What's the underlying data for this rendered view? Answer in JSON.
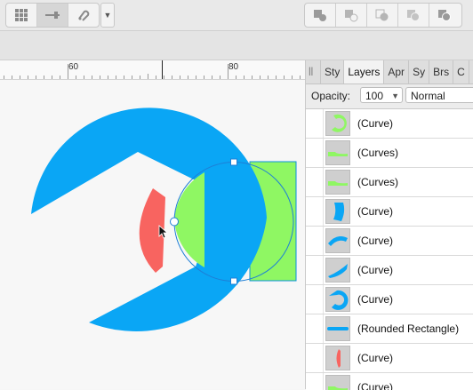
{
  "toolbar": {
    "left_group": [
      {
        "icon": "grid-icon"
      },
      {
        "icon": "snap-align-icon"
      },
      {
        "icon": "magnet-snapping-icon"
      }
    ],
    "dropdown_icon": "chevron-down-icon",
    "boolean_ops": [
      {
        "icon": "add-shape-icon"
      },
      {
        "icon": "subtract-shape-icon"
      },
      {
        "icon": "intersect-shape-icon"
      },
      {
        "icon": "xor-shape-icon"
      },
      {
        "icon": "divide-shape-icon"
      }
    ]
  },
  "ruler": {
    "ticks": [
      "60",
      "80"
    ]
  },
  "panel": {
    "tabs": [
      {
        "label": "Sty",
        "active": false
      },
      {
        "label": "Layers",
        "active": true
      },
      {
        "label": "Apr",
        "active": false
      },
      {
        "label": "Sy",
        "active": false
      },
      {
        "label": "Brs",
        "active": false
      },
      {
        "label": "C",
        "active": false
      }
    ],
    "opacity_label": "Opacity:",
    "opacity_value": "100",
    "blend_mode": "Normal",
    "layers": [
      {
        "name": "(Curve)",
        "thumb": "green-arc"
      },
      {
        "name": "(Curves)",
        "thumb": "green-bar"
      },
      {
        "name": "(Curves)",
        "thumb": "green-bar"
      },
      {
        "name": "(Curve)",
        "thumb": "blue-crescent"
      },
      {
        "name": "(Curve)",
        "thumb": "blue-arc"
      },
      {
        "name": "(Curve)",
        "thumb": "blue-swoosh"
      },
      {
        "name": "(Curve)",
        "thumb": "blue-ring"
      },
      {
        "name": "(Rounded Rectangle)",
        "thumb": "blue-pill"
      },
      {
        "name": "(Curve)",
        "thumb": "red-sliver"
      },
      {
        "name": "(Curve)",
        "thumb": "green-bar"
      }
    ]
  },
  "colors": {
    "blue": "#0aa6f5",
    "green": "#8ff763",
    "red": "#f86460"
  }
}
